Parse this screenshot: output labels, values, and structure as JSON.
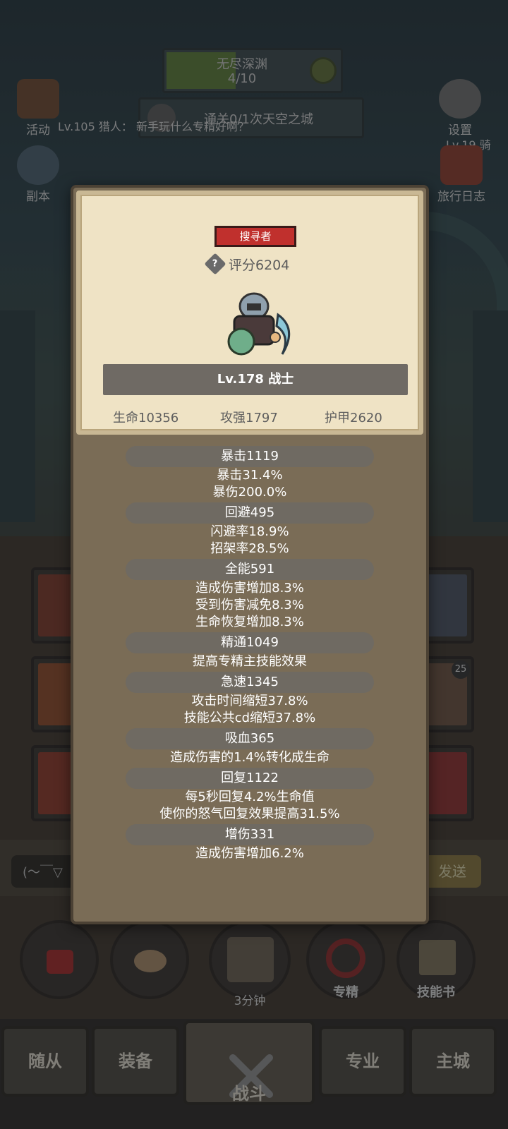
{
  "background": {
    "endless": {
      "title": "无尽深渊",
      "count": "4/10",
      "progress": 0.4
    },
    "quest": {
      "text": "通关0/1次天空之城"
    },
    "chat_line": "Lv.105 猎人： 新手玩什么专精好啊？",
    "left_icons": [
      {
        "label": "活动",
        "icon": "scroll-icon"
      },
      {
        "label": "副本",
        "icon": "portal-icon"
      }
    ],
    "right_icons": [
      {
        "label": "设置",
        "icon": "gear-icon"
      },
      {
        "label": "旅行日志",
        "icon": "journal-icon"
      }
    ],
    "right_level_text": "Lv.19 骑",
    "chat_input": "(～￣▽",
    "send_label": "发送",
    "skill_buttons": [
      {
        "label": "",
        "icon": "potion-icon"
      },
      {
        "label": "",
        "icon": "bread-icon"
      },
      {
        "label": "3分钟",
        "icon": "chest-icon"
      },
      {
        "label": "专精",
        "icon": "specialization-icon"
      },
      {
        "label": "技能书",
        "icon": "skillbook-icon"
      }
    ],
    "slot_badge": "25",
    "nav": [
      {
        "label": "随从"
      },
      {
        "label": "装备"
      },
      {
        "label": "战斗"
      },
      {
        "label": "专业"
      },
      {
        "label": "主城"
      }
    ]
  },
  "modal": {
    "role": "搜寻者",
    "score": "评分6204",
    "level_class": "Lv.178 战士",
    "stats": {
      "hp": "生命10356",
      "atk": "攻强1797",
      "armor": "护甲2620"
    },
    "attributes": [
      {
        "head": "暴击1119",
        "lines": [
          "暴击31.4%",
          "暴伤200.0%"
        ]
      },
      {
        "head": "回避495",
        "lines": [
          "闪避率18.9%",
          "招架率28.5%"
        ]
      },
      {
        "head": "全能591",
        "lines": [
          "造成伤害增加8.3%",
          "受到伤害减免8.3%",
          "生命恢复增加8.3%"
        ]
      },
      {
        "head": "精通1049",
        "lines": [
          "提高专精主技能效果"
        ]
      },
      {
        "head": "急速1345",
        "lines": [
          "攻击时间缩短37.8%",
          "技能公共cd缩短37.8%"
        ]
      },
      {
        "head": "吸血365",
        "lines": [
          "造成伤害的1.4%转化成生命"
        ]
      },
      {
        "head": "回复1122",
        "lines": [
          "每5秒回复4.2%生命值",
          "使你的怒气回复效果提高31.5%"
        ]
      },
      {
        "head": "增伤331",
        "lines": [
          "造成伤害增加6.2%"
        ]
      }
    ]
  }
}
